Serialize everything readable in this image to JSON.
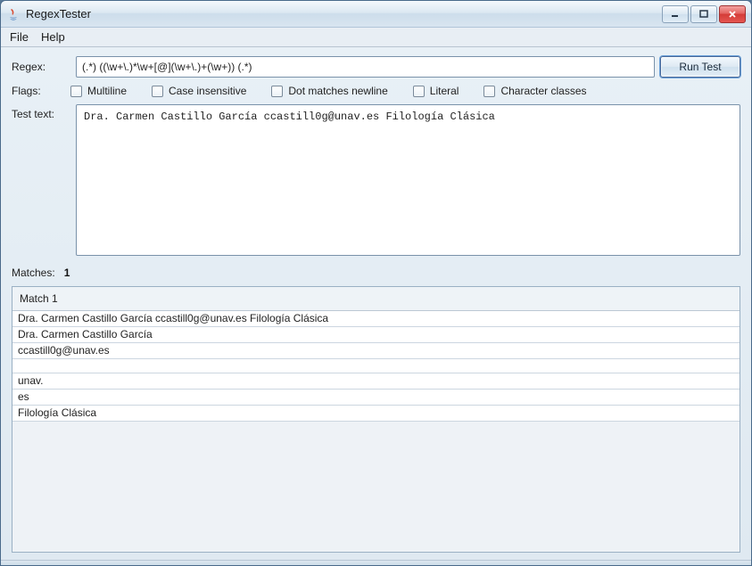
{
  "window": {
    "title": "RegexTester"
  },
  "menu": {
    "file": "File",
    "help": "Help"
  },
  "labels": {
    "regex": "Regex:",
    "flags": "Flags:",
    "test_text": "Test text:",
    "matches": "Matches:"
  },
  "regex": {
    "value": "(.*) ((\\w+\\.)*\\w+[@](\\w+\\.)+(\\w+)) (.*)"
  },
  "run_button": "Run Test",
  "flags": {
    "multiline": "Multiline",
    "case_insensitive": "Case insensitive",
    "dot_matches_newline": "Dot matches newline",
    "literal": "Literal",
    "character_classes": "Character classes"
  },
  "test_text": "Dra. Carmen Castillo García ccastill0g@unav.es Filología Clásica",
  "matches_count": "1",
  "results": {
    "header": "Match 1",
    "lines": [
      "Dra. Carmen Castillo García ccastill0g@unav.es Filología Clásica",
      "Dra. Carmen Castillo García",
      "ccastill0g@unav.es",
      "",
      "unav.",
      "es",
      "Filología Clásica"
    ]
  }
}
